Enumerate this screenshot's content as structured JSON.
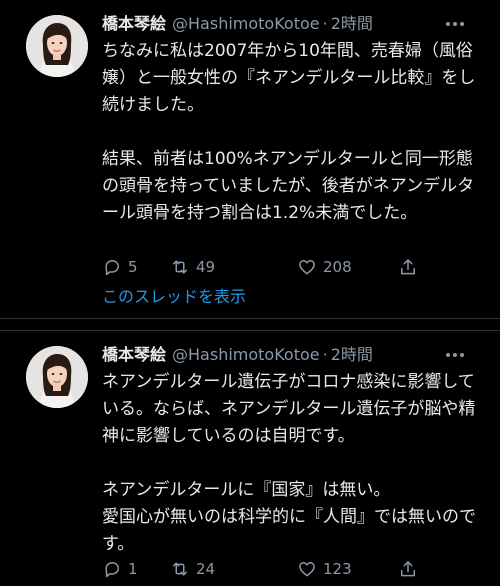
{
  "tweets": [
    {
      "name": "橋本琴絵",
      "handle": "@HashimotoKotoe",
      "separator": "·",
      "time": "2時間",
      "text": "ちなみに私は2007年から10年間、売春婦（風俗嬢）と一般女性の『ネアンデルタール比較』をし続けました。\n\n結果、前者は100%ネアンデルタールと同一形態の頭骨を持っていましたが、後者がネアンデルタール頭骨を持つ割合は1.2%未満でした。",
      "replies": "5",
      "retweets": "49",
      "likes": "208",
      "thread_link": "このスレッドを表示"
    },
    {
      "name": "橋本琴絵",
      "handle": "@HashimotoKotoe",
      "separator": "·",
      "time": "2時間",
      "text": "ネアンデルタール遺伝子がコロナ感染に影響している。ならば、ネアンデルタール遺伝子が脳や精神に影響しているのは自明です。\n\nネアンデルタールに『国家』は無い。\n愛国心が無いのは科学的に『人間』では無いのです。",
      "replies": "1",
      "retweets": "24",
      "likes": "123"
    }
  ],
  "icons": {
    "reply": "reply-icon",
    "retweet": "retweet-icon",
    "like": "heart-icon",
    "share": "share-icon",
    "more": "more-icon"
  },
  "colors": {
    "background": "#000000",
    "text": "#e7e9ea",
    "muted": "#8b98a5",
    "link": "#1d9bf0"
  }
}
